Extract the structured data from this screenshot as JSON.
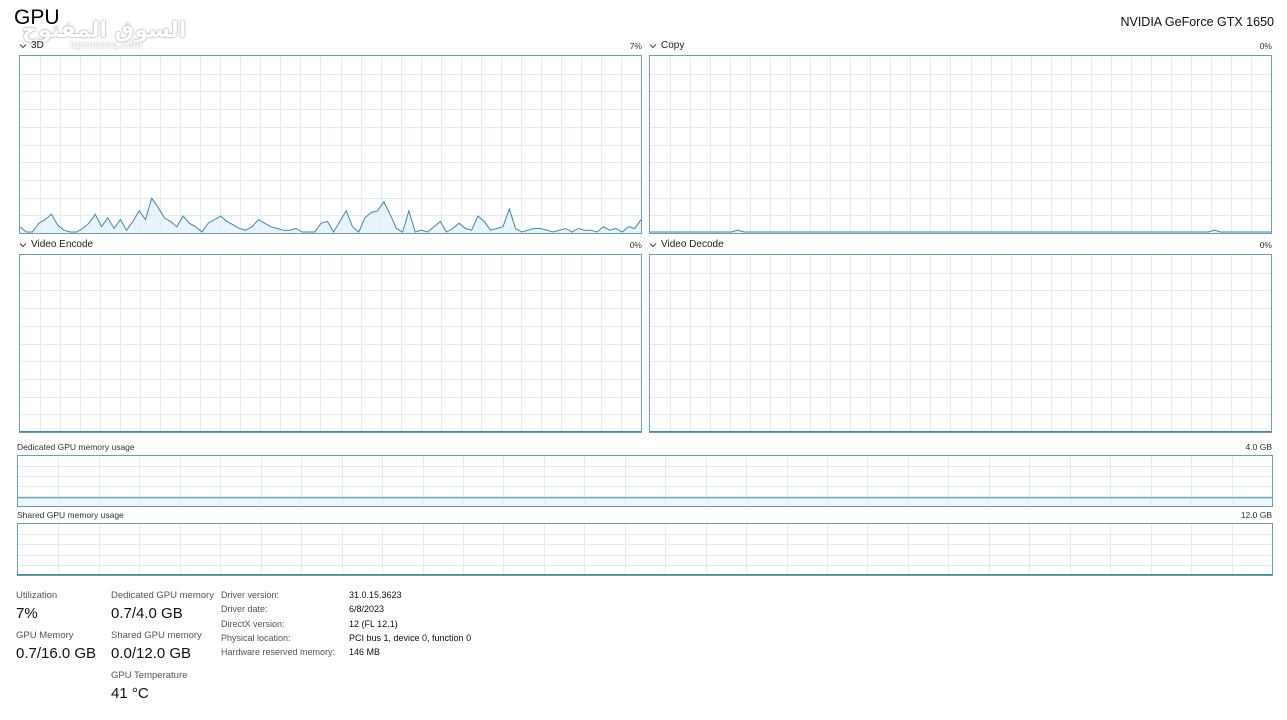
{
  "header": {
    "title": "GPU",
    "device": "NVIDIA GeForce GTX 1650"
  },
  "watermark": {
    "arabic": "السوق المفتوح",
    "latin": "opensooq.com"
  },
  "graphs": {
    "g3d": {
      "label": "3D",
      "percent": "7%",
      "samples": [
        3,
        0,
        0,
        5,
        7,
        10,
        4,
        1,
        0,
        0,
        2,
        5,
        10,
        3,
        8,
        2,
        7,
        1,
        6,
        12,
        7,
        19,
        14,
        8,
        6,
        3,
        9,
        5,
        3,
        0,
        5,
        7,
        9,
        6,
        4,
        2,
        1,
        3,
        7,
        5,
        3,
        2,
        1,
        1,
        2,
        0,
        0,
        0,
        5,
        6,
        0,
        6,
        12,
        3,
        0,
        8,
        11,
        12,
        17,
        10,
        2,
        0,
        12,
        0,
        1,
        0,
        3,
        6,
        0,
        2,
        5,
        2,
        1,
        9,
        6,
        1,
        2,
        3,
        13,
        2,
        0,
        1,
        2,
        2,
        1,
        0,
        1,
        2,
        0,
        2,
        1,
        1,
        0,
        3,
        1,
        2,
        0,
        3,
        2,
        7
      ]
    },
    "copy": {
      "label": "Copy",
      "percent": "0%",
      "samples": [
        0,
        0,
        0,
        0,
        0,
        0,
        0,
        0,
        0,
        0,
        0,
        0,
        0,
        0,
        1,
        0,
        0,
        0,
        0,
        0,
        0,
        0,
        0,
        0,
        0,
        0,
        0,
        0,
        0,
        0,
        0,
        0,
        0,
        0,
        0,
        0,
        0,
        0,
        0,
        0,
        0,
        0,
        0,
        0,
        0,
        0,
        0,
        0,
        0,
        0,
        0,
        0,
        0,
        0,
        0,
        0,
        0,
        0,
        0,
        0,
        0,
        0,
        0,
        0,
        0,
        0,
        0,
        0,
        0,
        0,
        0,
        0,
        0,
        0,
        0,
        0,
        0,
        0,
        0,
        0,
        0,
        0,
        0,
        0,
        0,
        0,
        0,
        0,
        0,
        0,
        1,
        0,
        0,
        0,
        0,
        0,
        0,
        0,
        0,
        0
      ]
    },
    "videoEncode": {
      "label": "Video Encode",
      "percent": "0%"
    },
    "videoDecode": {
      "label": "Video Decode",
      "percent": "0%"
    }
  },
  "memory": {
    "dedicated": {
      "label": "Dedicated GPU memory usage",
      "max": "4.0 GB",
      "used_fraction": 0.175
    },
    "shared": {
      "label": "Shared GPU memory usage",
      "max": "12.0 GB",
      "used_fraction": 0.0
    }
  },
  "stats": {
    "utilization": {
      "label": "Utilization",
      "value": "7%"
    },
    "gpu_memory": {
      "label": "GPU Memory",
      "value": "0.7/16.0 GB"
    },
    "dedicated_memory": {
      "label": "Dedicated GPU memory",
      "value": "0.7/4.0 GB"
    },
    "shared_memory": {
      "label": "Shared GPU memory",
      "value": "0.0/12.0 GB"
    },
    "temperature": {
      "label": "GPU Temperature",
      "value": "41 °C"
    }
  },
  "info": [
    {
      "label": "Driver version:",
      "value": "31.0.15.3623"
    },
    {
      "label": "Driver date:",
      "value": "6/8/2023"
    },
    {
      "label": "DirectX version:",
      "value": "12 (FL 12.1)"
    },
    {
      "label": "Physical location:",
      "value": "PCI bus 1, device 0, function 0"
    },
    {
      "label": "Hardware reserved memory:",
      "value": "146 MB"
    }
  ],
  "colors": {
    "border": "#6c9fb2",
    "grid": "#e2ecf1",
    "line": "#3b8ab0",
    "fill": "#e3f0f7"
  }
}
